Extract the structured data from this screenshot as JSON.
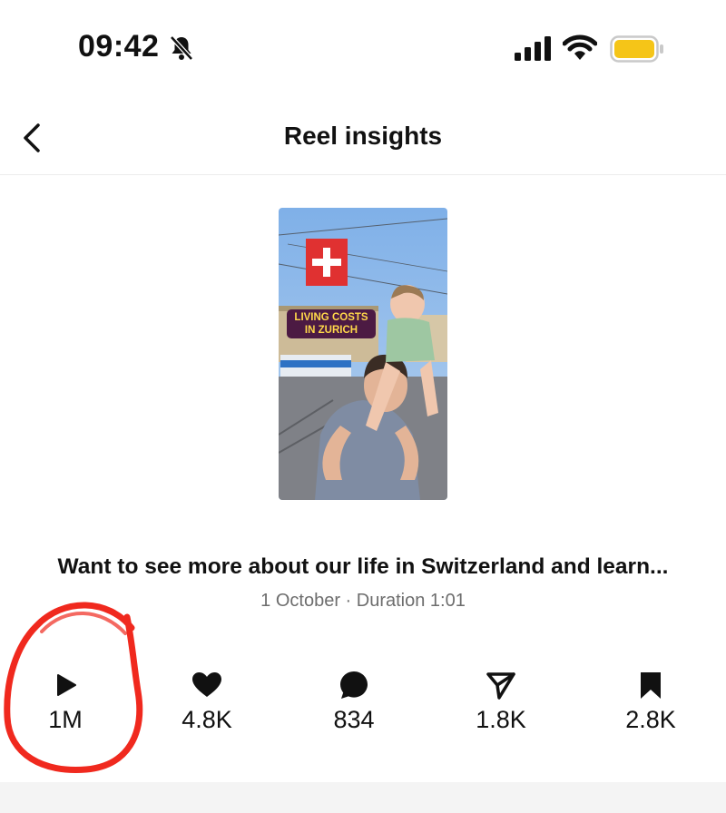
{
  "status_bar": {
    "time": "09:42",
    "icons": [
      "bell-slash-icon",
      "cellular-signal-icon",
      "wifi-icon",
      "battery-icon"
    ],
    "battery_color": "#f5c518"
  },
  "header": {
    "back_icon": "chevron-left-icon",
    "title": "Reel insights"
  },
  "reel": {
    "overlay_text_line1": "LIVING COSTS",
    "overlay_text_line2": "IN ZURICH",
    "caption": "Want to see more about our life in Switzerland and learn...",
    "meta": "1 October · Duration 1:01"
  },
  "stats": [
    {
      "icon": "play-icon",
      "value": "1M"
    },
    {
      "icon": "heart-icon",
      "value": "4.8K"
    },
    {
      "icon": "comment-icon",
      "value": "834"
    },
    {
      "icon": "share-icon",
      "value": "1.8K"
    },
    {
      "icon": "bookmark-icon",
      "value": "2.8K"
    }
  ],
  "annotation_color": "#f0291e"
}
